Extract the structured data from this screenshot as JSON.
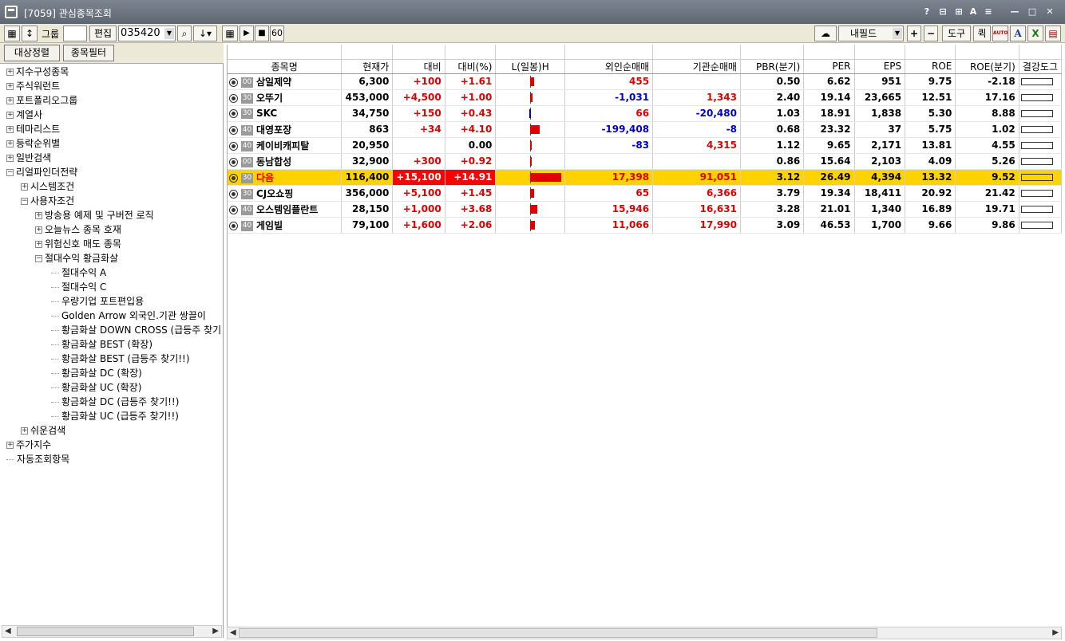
{
  "window": {
    "title": "[7059] 관심종목조회"
  },
  "toolbar": {
    "group_label": "그룹",
    "edit_label": "편집",
    "code_value": "035420",
    "play": "▶",
    "stop": "■",
    "sixty": "60",
    "field_select": "내필드",
    "plus": "+",
    "minus": "−",
    "tools": "도구",
    "quick": "퀵",
    "auto": "AUTO",
    "font": "A"
  },
  "left": {
    "btn_sort": "대상정렬",
    "btn_filter": "종목필터",
    "tree": [
      {
        "label": "지수구성종목",
        "exp": "+"
      },
      {
        "label": "주식워런트",
        "exp": "+"
      },
      {
        "label": "포트폴리오그룹",
        "exp": "+"
      },
      {
        "label": "계열사",
        "exp": "+"
      },
      {
        "label": "테마리스트",
        "exp": "+"
      },
      {
        "label": "등락순위별",
        "exp": "+"
      },
      {
        "label": "일반검색",
        "exp": "+"
      },
      {
        "label": "리얼파인더전략",
        "exp": "−"
      },
      {
        "label": "시스템조건",
        "exp": "+"
      },
      {
        "label": "사용자조건",
        "exp": "−"
      },
      {
        "label": "방송용 예제  및 구버전 로직",
        "exp": "+"
      },
      {
        "label": "오늘뉴스 종목 호재",
        "exp": "+"
      },
      {
        "label": "위험신호 매도 종목",
        "exp": "+"
      },
      {
        "label": "절대수익 황금화살",
        "exp": "−"
      },
      {
        "label": "절대수익 A",
        "exp": ""
      },
      {
        "label": "절대수익 C",
        "exp": ""
      },
      {
        "label": "우량기업 포트편입용",
        "exp": ""
      },
      {
        "label": "Golden Arrow   외국인.기관 쌍끌이",
        "exp": ""
      },
      {
        "label": "황금화살 DOWN  CROSS (급등주 찾기",
        "exp": ""
      },
      {
        "label": "황금화살 BEST (확장)",
        "exp": ""
      },
      {
        "label": "황금화살 BEST (급등주 찾기!!)",
        "exp": ""
      },
      {
        "label": "황금화살 DC (확장)",
        "exp": ""
      },
      {
        "label": "황금화살 UC (확장)",
        "exp": ""
      },
      {
        "label": "황금화살 DC (급등주 찾기!!)",
        "exp": ""
      },
      {
        "label": "황금화살 UC (급등주 찾기!!)",
        "exp": ""
      },
      {
        "label": "쉬운검색",
        "exp": "+"
      },
      {
        "label": "주가지수",
        "exp": "+"
      },
      {
        "label": "자동조회항목",
        "exp": ""
      }
    ]
  },
  "grid": {
    "headers": [
      "종목명",
      "현재가",
      "대비",
      "대비(%)",
      "L(일봉)H",
      "외인순매매",
      "기관순매매",
      "PBR(분기)",
      "PER",
      "EPS",
      "ROE",
      "ROE(분기)",
      "결강도그"
    ],
    "rows": [
      {
        "badge": "00",
        "name": "삼일제약",
        "price": "6,300",
        "diff": "+100",
        "pct": "+1.61",
        "bar": 0.3,
        "frgn": "455",
        "inst": "",
        "pbr": "0.50",
        "per": "6.62",
        "eps": "951",
        "roe": "9.75",
        "roeq": "-2.18"
      },
      {
        "badge": "30",
        "name": "오뚜기",
        "price": "453,000",
        "diff": "+4,500",
        "pct": "+1.00",
        "bar": 0.2,
        "frgn": "-1,031",
        "inst": "1,343",
        "pbr": "2.40",
        "per": "19.14",
        "eps": "23,665",
        "roe": "12.51",
        "roeq": "17.16"
      },
      {
        "badge": "30",
        "name": "SKC",
        "price": "34,750",
        "diff": "+150",
        "pct": "+0.43",
        "bar": -0.1,
        "frgn": "66",
        "inst": "-20,480",
        "pbr": "1.03",
        "per": "18.91",
        "eps": "1,838",
        "roe": "5.30",
        "roeq": "8.88"
      },
      {
        "badge": "40",
        "name": "대영포장",
        "price": "863",
        "diff": "+34",
        "pct": "+4.10",
        "bar": 0.8,
        "frgn": "-199,408",
        "inst": "-8",
        "pbr": "0.68",
        "per": "23.32",
        "eps": "37",
        "roe": "5.75",
        "roeq": "1.02"
      },
      {
        "badge": "40",
        "name": "케이비캐피탈",
        "price": "20,950",
        "diff": "",
        "pct": "0.00",
        "bar": 0.1,
        "frgn": "-83",
        "inst": "4,315",
        "pbr": "1.12",
        "per": "9.65",
        "eps": "2,171",
        "roe": "13.81",
        "roeq": "4.55"
      },
      {
        "badge": "00",
        "name": "동남합성",
        "price": "32,900",
        "diff": "+300",
        "pct": "+0.92",
        "bar": 0.05,
        "frgn": "",
        "inst": "",
        "pbr": "0.86",
        "per": "15.64",
        "eps": "2,103",
        "roe": "4.09",
        "roeq": "5.26"
      },
      {
        "badge": "30",
        "name": "다음",
        "price": "116,400",
        "diff": "+15,100",
        "pct": "+14.91",
        "bar": 2.6,
        "frgn": "17,398",
        "inst": "91,051",
        "pbr": "3.12",
        "per": "26.49",
        "eps": "4,394",
        "roe": "13.32",
        "roeq": "9.52"
      },
      {
        "badge": "30",
        "name": "CJ오쇼핑",
        "price": "356,000",
        "diff": "+5,100",
        "pct": "+1.45",
        "bar": 0.3,
        "frgn": "65",
        "inst": "6,366",
        "pbr": "3.79",
        "per": "19.34",
        "eps": "18,411",
        "roe": "20.92",
        "roeq": "21.42"
      },
      {
        "badge": "40",
        "name": "오스템임플란트",
        "price": "28,150",
        "diff": "+1,000",
        "pct": "+3.68",
        "bar": 0.6,
        "frgn": "15,946",
        "inst": "16,631",
        "pbr": "3.28",
        "per": "21.01",
        "eps": "1,340",
        "roe": "16.89",
        "roeq": "19.71"
      },
      {
        "badge": "40",
        "name": "게임빌",
        "price": "79,100",
        "diff": "+1,600",
        "pct": "+2.06",
        "bar": 0.4,
        "frgn": "11,066",
        "inst": "17,990",
        "pbr": "3.09",
        "per": "46.53",
        "eps": "1,700",
        "roe": "9.66",
        "roeq": "9.86"
      }
    ]
  }
}
